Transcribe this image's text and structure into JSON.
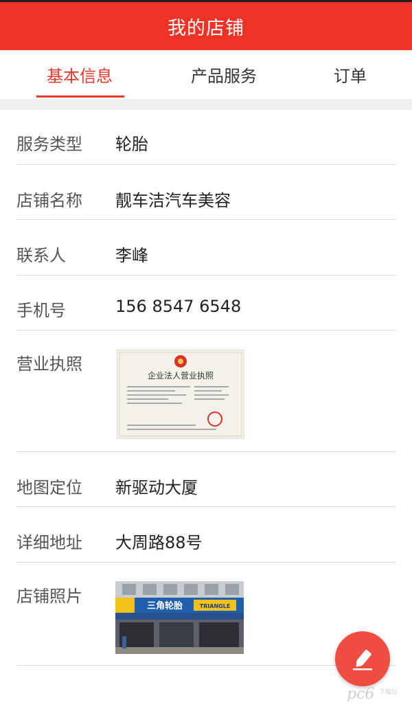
{
  "header": {
    "title": "我的店铺"
  },
  "tabs": [
    {
      "label": "基本信息",
      "active": true
    },
    {
      "label": "产品服务",
      "active": false
    },
    {
      "label": "订单",
      "active": false
    }
  ],
  "colors": {
    "brand": "#ef3226",
    "active_tab": "#e8382b",
    "fab": "#ef4c42"
  },
  "fields": {
    "service_type": {
      "label": "服务类型",
      "value": "轮胎"
    },
    "shop_name": {
      "label": "店铺名称",
      "value": "靓车洁汽车美容"
    },
    "contact": {
      "label": "联系人",
      "value": "李峰"
    },
    "phone": {
      "label": "手机号",
      "value": "156 8547 6548"
    },
    "license": {
      "label": "营业执照",
      "image_title": "企业法人营业执照"
    },
    "map_location": {
      "label": "地图定位",
      "value": "新驱动大厦"
    },
    "address": {
      "label": "详细地址",
      "value": "大周路88号"
    },
    "shop_photo": {
      "label": "店铺照片",
      "sign_text": "三角轮胎",
      "sign_text_en": "TRIANGLE"
    }
  },
  "fab": {
    "icon": "edit-pencil-icon"
  },
  "watermark": {
    "text": "pc6",
    "sub": "下载站"
  }
}
